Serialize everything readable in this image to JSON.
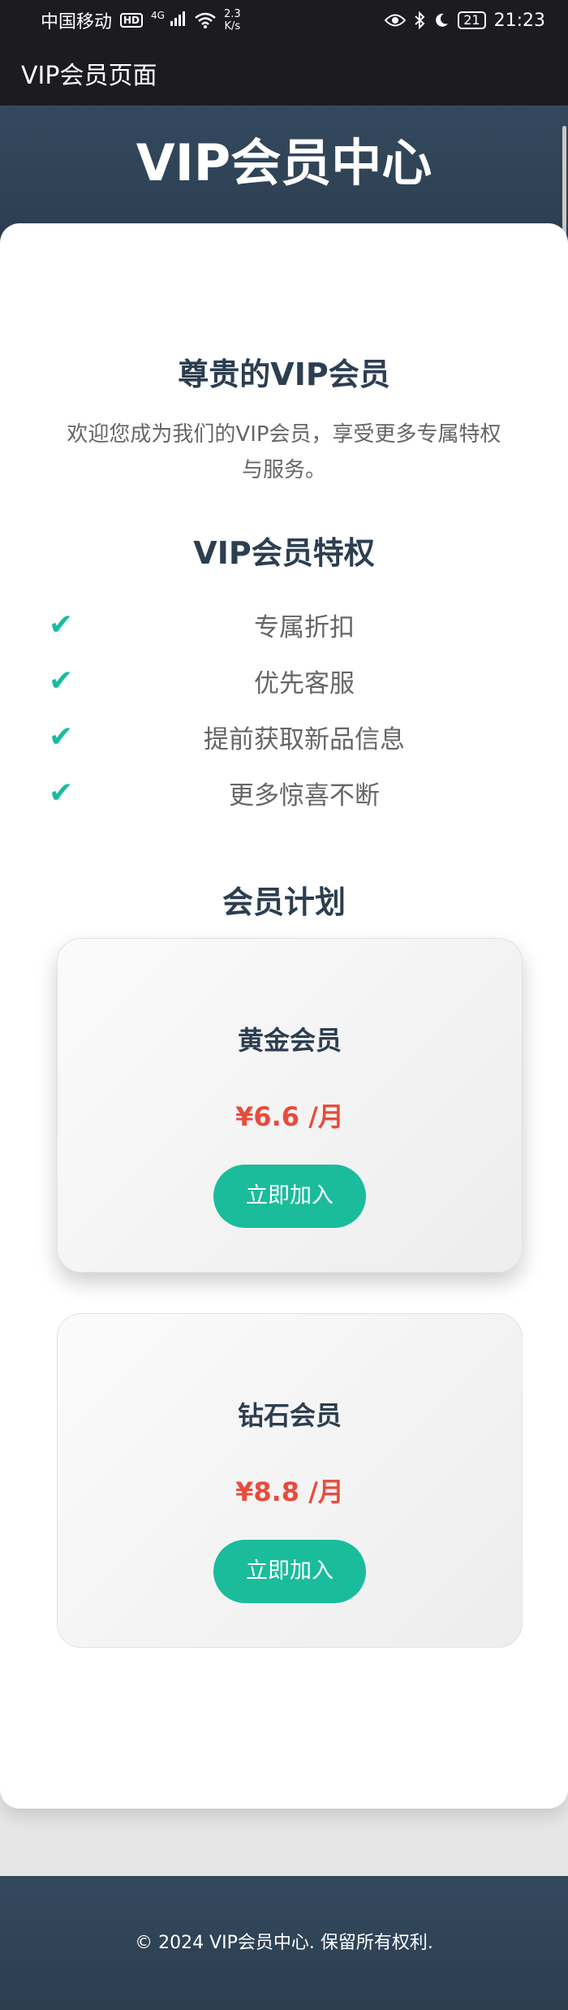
{
  "status_bar": {
    "carrier": "中国移动",
    "hd_badge": "HD",
    "signal_label": "4G",
    "speed_value": "2.3",
    "speed_unit": "K/s",
    "battery": "21",
    "time": "21:23",
    "icons": [
      "eye-icon",
      "bluetooth-icon",
      "moon-icon"
    ]
  },
  "app_bar": {
    "title": "VIP会员页面"
  },
  "header": {
    "title": "VIP会员中心"
  },
  "welcome": {
    "title": "尊贵的VIP会员",
    "text": "欢迎您成为我们的VIP会员，享受更多专属特权与服务。"
  },
  "perks": {
    "title": "VIP会员特权",
    "check_glyph": "✔",
    "items": [
      {
        "label": "专属折扣"
      },
      {
        "label": "优先客服"
      },
      {
        "label": "提前获取新品信息"
      },
      {
        "label": "更多惊喜不断"
      }
    ]
  },
  "plans": {
    "title": "会员计划",
    "items": [
      {
        "name": "黄金会员",
        "price": "¥6.6 /月",
        "button": "立即加入"
      },
      {
        "name": "钻石会员",
        "price": "¥8.8 /月",
        "button": "立即加入"
      }
    ]
  },
  "footer": {
    "text": "© 2024 VIP会员中心. 保留所有权利."
  },
  "colors": {
    "accent": "#1abc9c",
    "price": "#e74c3c",
    "heading": "#2c3e50",
    "header_bg": "#34495e"
  }
}
